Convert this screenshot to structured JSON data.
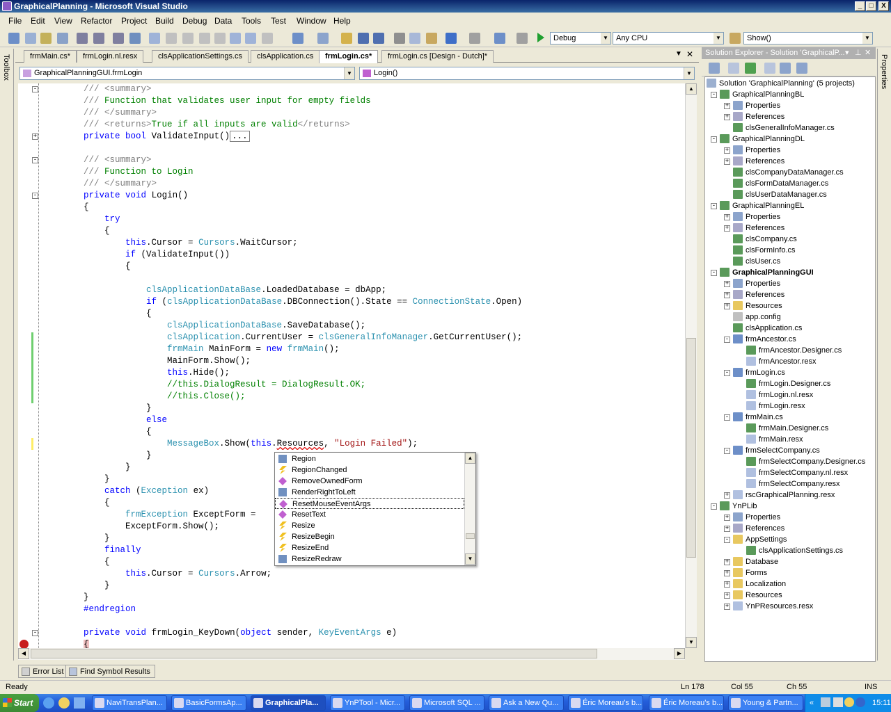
{
  "window": {
    "title": "GraphicalPlanning - Microsoft Visual Studio",
    "min": "_",
    "max": "□",
    "close": "X"
  },
  "menu": [
    "File",
    "Edit",
    "View",
    "Refactor",
    "Project",
    "Build",
    "Debug",
    "Data",
    "Tools",
    "Test",
    "Window",
    "Help"
  ],
  "toolbar": {
    "config": "Debug",
    "platform": "Any CPU",
    "find": "Show()"
  },
  "side_strips": {
    "toolbox": "Toolbox",
    "properties": "Properties"
  },
  "doc_tabs": [
    {
      "label": "frmMain.cs*",
      "active": false
    },
    {
      "label": "frmLogin.nl.resx",
      "active": false
    },
    {
      "label": "clsApplicationSettings.cs",
      "active": false
    },
    {
      "label": "clsApplication.cs",
      "active": false
    },
    {
      "label": "frmLogin.cs*",
      "active": true
    },
    {
      "label": "frmLogin.cs [Design - Dutch]*",
      "active": false
    }
  ],
  "doc_tab_controls": {
    "dropdown": "▼",
    "close": "✕"
  },
  "navbar": {
    "class_combo": "GraphicalPlanningGUI.frmLogin",
    "member_combo": "Login()"
  },
  "code": [
    "        /// <summary>",
    "        /// Function that validates user input for empty fields",
    "        /// </summary>",
    "        /// <returns>True if all inputs are valid</returns>",
    "        private bool ValidateInput()...",
    "",
    "        /// <summary>",
    "        /// Function to Login",
    "        /// </summary>",
    "        private void Login()",
    "        {",
    "            try",
    "            {",
    "                this.Cursor = Cursors.WaitCursor;",
    "                if (ValidateInput())",
    "                {",
    "",
    "                    clsApplicationDataBase.LoadedDatabase = dbApp;",
    "                    if (clsApplicationDataBase.DBConnection().State == ConnectionState.Open)",
    "                    {",
    "                        clsApplicationDataBase.SaveDatabase();",
    "                        clsApplication.CurrentUser = clsGeneralInfoManager.GetCurrentUser();",
    "                        frmMain MainForm = new frmMain();",
    "                        MainForm.Show();",
    "                        this.Hide();",
    "                        //this.DialogResult = DialogResult.OK;",
    "                        //this.Close();",
    "                    }",
    "                    else",
    "                    {",
    "                        MessageBox.Show(this.Resources, \"Login Failed\");",
    "                    }",
    "                }",
    "            }",
    "            catch (Exception ex)",
    "            {",
    "                frmException ExceptForm = ",
    "                ExceptForm.Show();",
    "            }",
    "            finally",
    "            {",
    "                this.Cursor = Cursors.Arrow;",
    "            }",
    "        }",
    "        #endregion",
    "",
    "        private void frmLogin_KeyDown(object sender, KeyEventArgs e)",
    "        {"
  ],
  "intellisense": {
    "items": [
      {
        "label": "Region",
        "kind": "property-icon"
      },
      {
        "label": "RegionChanged",
        "kind": "event-icon"
      },
      {
        "label": "RemoveOwnedForm",
        "kind": "method-icon"
      },
      {
        "label": "RenderRightToLeft",
        "kind": "property-icon"
      },
      {
        "label": "ResetMouseEventArgs",
        "kind": "method-icon"
      },
      {
        "label": "ResetText",
        "kind": "method-icon"
      },
      {
        "label": "Resize",
        "kind": "event-icon"
      },
      {
        "label": "ResizeBegin",
        "kind": "event-icon"
      },
      {
        "label": "ResizeEnd",
        "kind": "event-icon"
      },
      {
        "label": "ResizeRedraw",
        "kind": "property-icon"
      }
    ],
    "selected_index": 4,
    "scroll_up": "▲",
    "scroll_down": "▼"
  },
  "solution_explorer": {
    "title": "Solution Explorer - Solution 'GraphicalP...",
    "title_controls": {
      "dropdown": "▾",
      "pin": "⊥",
      "close": "✕"
    },
    "items": [
      {
        "label": "Solution 'GraphicalPlanning' (5 projects)",
        "level": 0,
        "icon": "solution-icon",
        "exp": ""
      },
      {
        "label": "GraphicalPlanningBL",
        "level": 1,
        "icon": "project-icon",
        "exp": "-"
      },
      {
        "label": "Properties",
        "level": 2,
        "icon": "properties-folder-icon",
        "exp": "+"
      },
      {
        "label": "References",
        "level": 2,
        "icon": "references-icon",
        "exp": "+"
      },
      {
        "label": "clsGeneralInfoManager.cs",
        "level": 2,
        "icon": "cs-file-icon",
        "exp": ""
      },
      {
        "label": "GraphicalPlanningDL",
        "level": 1,
        "icon": "project-icon",
        "exp": "-"
      },
      {
        "label": "Properties",
        "level": 2,
        "icon": "properties-folder-icon",
        "exp": "+"
      },
      {
        "label": "References",
        "level": 2,
        "icon": "references-icon",
        "exp": "+"
      },
      {
        "label": "clsCompanyDataManager.cs",
        "level": 2,
        "icon": "cs-file-icon",
        "exp": ""
      },
      {
        "label": "clsFormDataManager.cs",
        "level": 2,
        "icon": "cs-file-icon",
        "exp": ""
      },
      {
        "label": "clsUserDataManager.cs",
        "level": 2,
        "icon": "cs-file-icon",
        "exp": ""
      },
      {
        "label": "GraphicalPlanningEL",
        "level": 1,
        "icon": "project-icon",
        "exp": "-"
      },
      {
        "label": "Properties",
        "level": 2,
        "icon": "properties-folder-icon",
        "exp": "+"
      },
      {
        "label": "References",
        "level": 2,
        "icon": "references-icon",
        "exp": "+"
      },
      {
        "label": "clsCompany.cs",
        "level": 2,
        "icon": "cs-file-icon",
        "exp": ""
      },
      {
        "label": "clsFormInfo.cs",
        "level": 2,
        "icon": "cs-file-icon",
        "exp": ""
      },
      {
        "label": "clsUser.cs",
        "level": 2,
        "icon": "cs-file-icon",
        "exp": ""
      },
      {
        "label": "GraphicalPlanningGUI",
        "level": 1,
        "icon": "project-icon",
        "exp": "-",
        "bold": true
      },
      {
        "label": "Properties",
        "level": 2,
        "icon": "properties-folder-icon",
        "exp": "+"
      },
      {
        "label": "References",
        "level": 2,
        "icon": "references-icon",
        "exp": "+"
      },
      {
        "label": "Resources",
        "level": 2,
        "icon": "folder-icon",
        "exp": "+"
      },
      {
        "label": "app.config",
        "level": 2,
        "icon": "config-file-icon",
        "exp": ""
      },
      {
        "label": "clsApplication.cs",
        "level": 2,
        "icon": "cs-file-icon",
        "exp": ""
      },
      {
        "label": "frmAncestor.cs",
        "level": 2,
        "icon": "form-icon",
        "exp": "-"
      },
      {
        "label": "frmAncestor.Designer.cs",
        "level": 3,
        "icon": "cs-file-icon",
        "exp": ""
      },
      {
        "label": "frmAncestor.resx",
        "level": 3,
        "icon": "resx-file-icon",
        "exp": ""
      },
      {
        "label": "frmLogin.cs",
        "level": 2,
        "icon": "form-icon",
        "exp": "-"
      },
      {
        "label": "frmLogin.Designer.cs",
        "level": 3,
        "icon": "cs-file-icon",
        "exp": ""
      },
      {
        "label": "frmLogin.nl.resx",
        "level": 3,
        "icon": "resx-file-icon",
        "exp": ""
      },
      {
        "label": "frmLogin.resx",
        "level": 3,
        "icon": "resx-file-icon",
        "exp": ""
      },
      {
        "label": "frmMain.cs",
        "level": 2,
        "icon": "form-icon",
        "exp": "-"
      },
      {
        "label": "frmMain.Designer.cs",
        "level": 3,
        "icon": "cs-file-icon",
        "exp": ""
      },
      {
        "label": "frmMain.resx",
        "level": 3,
        "icon": "resx-file-icon",
        "exp": ""
      },
      {
        "label": "frmSelectCompany.cs",
        "level": 2,
        "icon": "form-icon",
        "exp": "-"
      },
      {
        "label": "frmSelectCompany.Designer.cs",
        "level": 3,
        "icon": "cs-file-icon",
        "exp": ""
      },
      {
        "label": "frmSelectCompany.nl.resx",
        "level": 3,
        "icon": "resx-file-icon",
        "exp": ""
      },
      {
        "label": "frmSelectCompany.resx",
        "level": 3,
        "icon": "resx-file-icon",
        "exp": ""
      },
      {
        "label": "rscGraphicalPlanning.resx",
        "level": 2,
        "icon": "resx-file-icon",
        "exp": "+"
      },
      {
        "label": "YnPLib",
        "level": 1,
        "icon": "project-icon",
        "exp": "-"
      },
      {
        "label": "Properties",
        "level": 2,
        "icon": "properties-folder-icon",
        "exp": "+"
      },
      {
        "label": "References",
        "level": 2,
        "icon": "references-icon",
        "exp": "+"
      },
      {
        "label": "AppSettings",
        "level": 2,
        "icon": "open-folder-icon",
        "exp": "-"
      },
      {
        "label": "clsApplicationSettings.cs",
        "level": 3,
        "icon": "cs-file-icon",
        "exp": ""
      },
      {
        "label": "Database",
        "level": 2,
        "icon": "folder-icon",
        "exp": "+"
      },
      {
        "label": "Forms",
        "level": 2,
        "icon": "folder-icon",
        "exp": "+"
      },
      {
        "label": "Localization",
        "level": 2,
        "icon": "folder-icon",
        "exp": "+"
      },
      {
        "label": "Resources",
        "level": 2,
        "icon": "folder-icon",
        "exp": "+"
      },
      {
        "label": "YnPResources.resx",
        "level": 2,
        "icon": "resx-file-icon",
        "exp": "+"
      }
    ]
  },
  "bottom_tabs": [
    "Error List",
    "Find Symbol Results"
  ],
  "status": {
    "text": "Ready",
    "line": "Ln 178",
    "col": "Col 55",
    "ch": "Ch 55",
    "mode": "INS"
  },
  "taskbar": {
    "start": "Start",
    "tasks": [
      "NaviTransPlan...",
      "BasicFormsAp...",
      "GraphicalPla...",
      "YnPTool - Micr...",
      "Microsoft SQL ...",
      "Ask a New Qu...",
      "Éric Moreau's b...",
      "Éric Moreau's b...",
      "Young & Partn..."
    ],
    "active_index": 2,
    "clock": "15:11",
    "chevron": "«"
  },
  "colors": {
    "keyword": "#0000ff",
    "comment": "#008000",
    "type": "#2b91af",
    "string": "#a31515",
    "change_bar": "#6fcf6f",
    "unsaved_bar": "#ffee66"
  }
}
